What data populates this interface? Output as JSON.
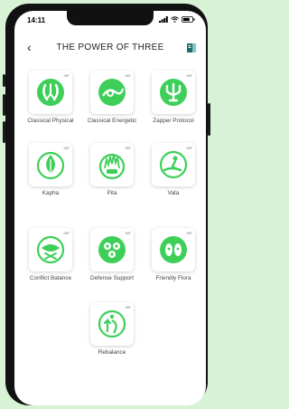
{
  "status_bar": {
    "time": "14:11"
  },
  "header": {
    "title": "THE POWER OF THREE",
    "back_glyph": "‹"
  },
  "badge_text": "INF",
  "accent_color": "#3ecf59",
  "tiles": [
    {
      "label": "Classical Physical",
      "icon": "organs-icon"
    },
    {
      "label": "Classical Energetic",
      "icon": "energy-flow-icon"
    },
    {
      "label": "Zapper Protocol",
      "icon": "trident-icon"
    },
    {
      "label": "Kapha",
      "icon": "leaf-icon"
    },
    {
      "label": "Pita",
      "icon": "flame-icon"
    },
    {
      "label": "Vata",
      "icon": "wind-figure-icon"
    },
    {
      "label": "Conflict Balance",
      "icon": "conflict-icon"
    },
    {
      "label": "Defense Support",
      "icon": "cells-icon"
    },
    {
      "label": "Friendly Flora",
      "icon": "flora-icon"
    },
    {
      "label": "Rebalance",
      "icon": "rebalance-icon"
    }
  ]
}
